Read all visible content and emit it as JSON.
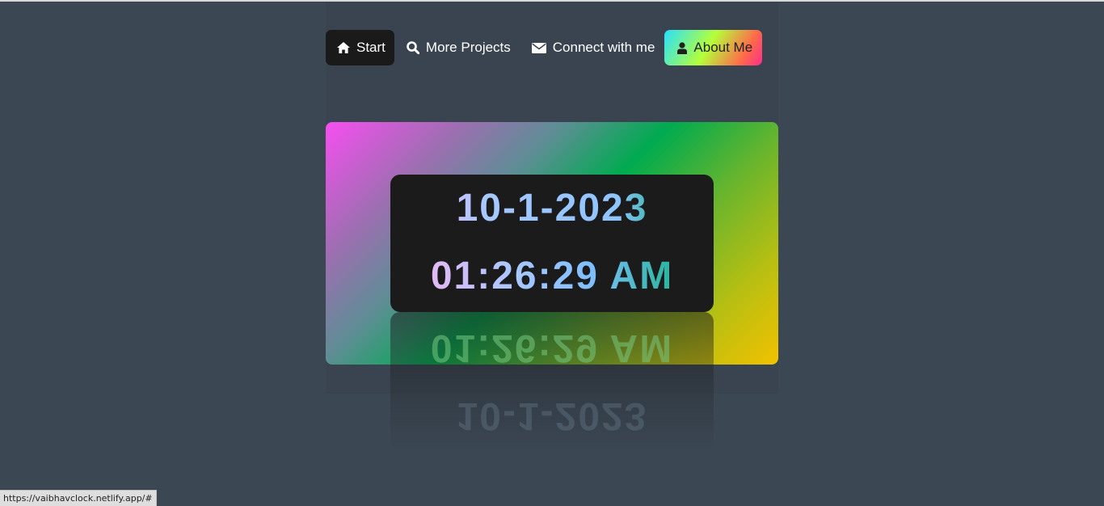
{
  "nav": {
    "items": [
      {
        "label": "Start",
        "icon": "home-icon",
        "active": true
      },
      {
        "label": "More Projects",
        "icon": "search-icon"
      },
      {
        "label": "Connect with me",
        "icon": "envelope-icon"
      },
      {
        "label": "About Me",
        "icon": "user-icon"
      }
    ]
  },
  "clock": {
    "date": "10-1-2023",
    "time": "01:26:29 AM"
  },
  "status_bar": {
    "url": "https://vaibhavclock.netlify.app/#"
  },
  "colors": {
    "background": "#3b4753",
    "clock_box": "#1b1b1c",
    "start_active": "#1a1a1a"
  }
}
